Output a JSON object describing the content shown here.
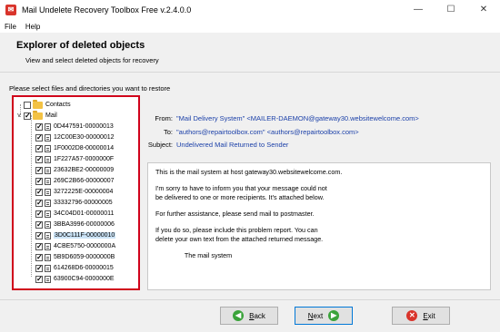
{
  "window": {
    "title": "Mail Undelete Recovery Toolbox Free v.2.4.0.0",
    "minimize": "—",
    "maximize": "☐",
    "close": "✕"
  },
  "menu": [
    "File",
    "Help"
  ],
  "header": {
    "title": "Explorer of deleted objects",
    "subtitle": "View and select deleted objects for recovery"
  },
  "instruction": "Please select files and directories you want to restore",
  "tree": {
    "contacts": "Contacts",
    "mail": "Mail",
    "items": [
      {
        "label": "0D447591-00000013",
        "checked": true,
        "selected": false
      },
      {
        "label": "12C00E30-00000012",
        "checked": true,
        "selected": false
      },
      {
        "label": "1F0002D8-00000014",
        "checked": true,
        "selected": false
      },
      {
        "label": "1F227A57-0000000F",
        "checked": true,
        "selected": false
      },
      {
        "label": "23632BE2-00000009",
        "checked": true,
        "selected": false
      },
      {
        "label": "269C2B66-00000007",
        "checked": true,
        "selected": false
      },
      {
        "label": "3272225E-00000004",
        "checked": true,
        "selected": false
      },
      {
        "label": "33332796-00000005",
        "checked": true,
        "selected": false
      },
      {
        "label": "34C04D01-00000011",
        "checked": true,
        "selected": false
      },
      {
        "label": "3BBA3996-00000006",
        "checked": true,
        "selected": false
      },
      {
        "label": "3D0C111F-00000010",
        "checked": true,
        "selected": true
      },
      {
        "label": "4CBE5750-0000000A",
        "checked": true,
        "selected": false
      },
      {
        "label": "5B9D6059-0000000B",
        "checked": true,
        "selected": false
      },
      {
        "label": "614268D6-00000015",
        "checked": true,
        "selected": false
      },
      {
        "label": "63900C94-0000000E",
        "checked": true,
        "selected": false
      }
    ]
  },
  "message": {
    "from_label": "From:",
    "from_value": "\"Mail Delivery System\" <MAILER-DAEMON@gateway30.websitewelcome.com>",
    "to_label": "To:",
    "to_value": "\"authors@repairtoolbox.com\" <authors@repairtoolbox.com>",
    "subject_label": "Subject:",
    "subject_value": "Undelivered Mail Returned to Sender",
    "body": [
      "This is the mail system at host gateway30.websitewelcome.com.",
      "",
      "I'm sorry to have to inform you that your message could not",
      "be delivered to one or more recipients. It's attached below.",
      "",
      "For further assistance, please send mail to postmaster.",
      "",
      "If you do so, please include this problem report. You can",
      "delete your own text from the attached returned message.",
      "",
      "                The mail system"
    ]
  },
  "buttons": {
    "back_first": "B",
    "back_rest": "ack",
    "next_first": "N",
    "next_rest": "ext",
    "exit_first": "E",
    "exit_rest": "xit"
  },
  "colors": {
    "highlight_border": "#d0021b",
    "link_blue": "#1a3fa8",
    "selection": "#cce4f7"
  }
}
